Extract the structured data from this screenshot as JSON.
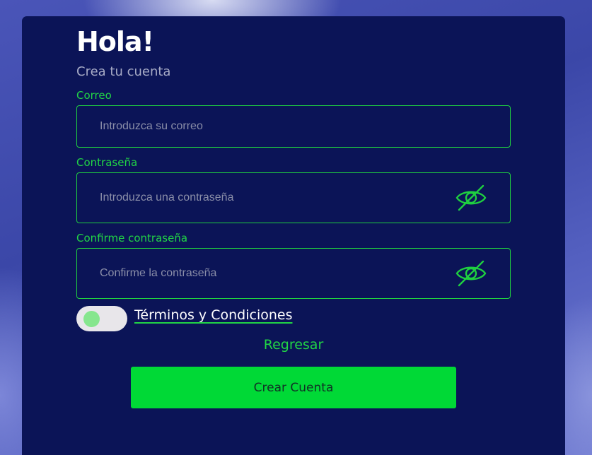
{
  "header": {
    "title": "Hola!",
    "subtitle": "Crea tu cuenta"
  },
  "form": {
    "email": {
      "label": "Correo",
      "placeholder": "Introduzca su correo",
      "value": ""
    },
    "password": {
      "label": "Contraseña",
      "placeholder": "Introduzca una contraseña",
      "value": "",
      "icon": "eye-off-icon"
    },
    "confirm_password": {
      "label": "Confirme contraseña",
      "placeholder": "Confirme la contraseña",
      "value": "",
      "icon": "eye-off-icon"
    },
    "terms": {
      "label": "Términos y Condiciones",
      "accepted": false
    },
    "back_link": "Regresar",
    "submit_label": "Crear Cuenta"
  },
  "colors": {
    "card_background": "#0b1457",
    "accent_green": "#21d545",
    "button_green": "#00d936",
    "title_white": "#ffffff",
    "subtitle_gray": "#a7abc6"
  }
}
